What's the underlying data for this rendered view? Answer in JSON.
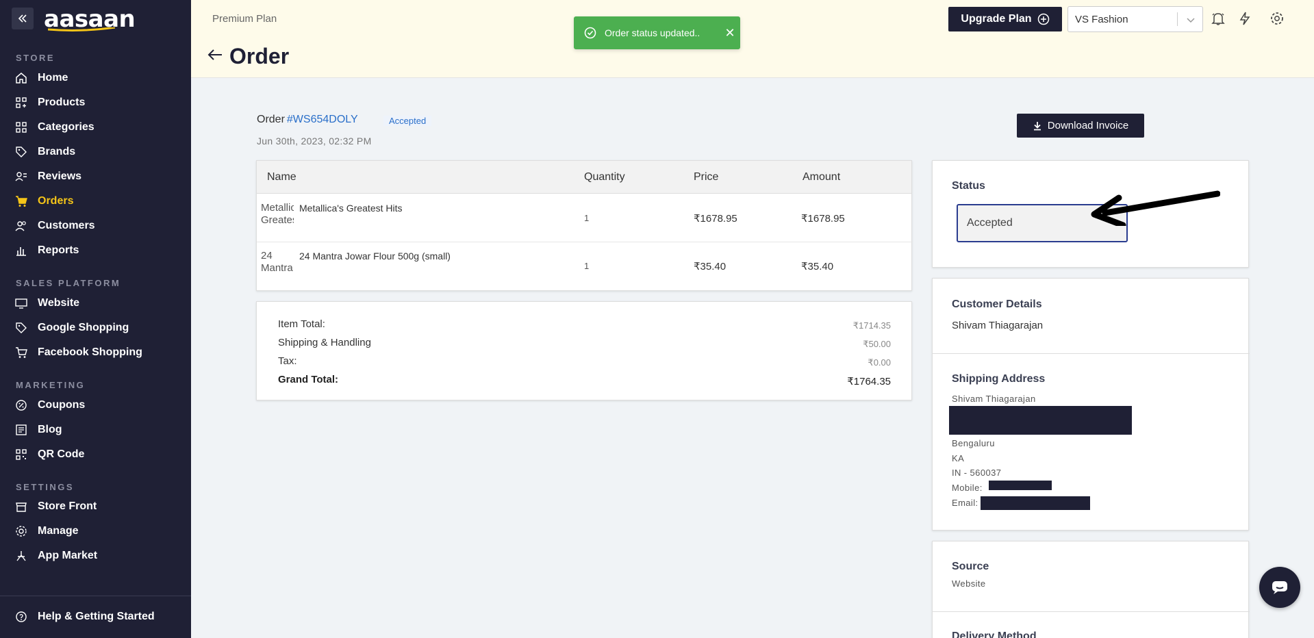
{
  "sidebar": {
    "logo": "aasaan",
    "sections": {
      "store": "STORE",
      "sales_platform": "SALES PLATFORM",
      "marketing": "MARKETING",
      "settings": "SETTINGS"
    },
    "items": [
      {
        "label": "Home",
        "icon": "home-icon"
      },
      {
        "label": "Products",
        "icon": "grid-icon"
      },
      {
        "label": "Categories",
        "icon": "categories-icon"
      },
      {
        "label": "Brands",
        "icon": "tag-icon"
      },
      {
        "label": "Reviews",
        "icon": "reviews-icon"
      },
      {
        "label": "Orders",
        "icon": "cart-icon",
        "active": true
      },
      {
        "label": "Customers",
        "icon": "users-icon"
      },
      {
        "label": "Reports",
        "icon": "bar-chart-icon"
      },
      {
        "label": "Website",
        "icon": "monitor-icon"
      },
      {
        "label": "Google Shopping",
        "icon": "google-tag-icon"
      },
      {
        "label": "Facebook Shopping",
        "icon": "cart-outline-icon"
      },
      {
        "label": "Coupons",
        "icon": "coupon-icon"
      },
      {
        "label": "Blog",
        "icon": "blog-icon"
      },
      {
        "label": "QR Code",
        "icon": "qr-icon"
      },
      {
        "label": "Store Front",
        "icon": "storefront-icon"
      },
      {
        "label": "Manage",
        "icon": "gear-icon"
      },
      {
        "label": "App Market",
        "icon": "app-market-icon"
      }
    ],
    "help": "Help & Getting Started"
  },
  "header": {
    "plan": "Premium Plan",
    "title": "Order",
    "toast": "Order status updated..",
    "upgrade": "Upgrade Plan",
    "store": "VS Fashion"
  },
  "order": {
    "label": "Order",
    "id": "#WS654DOLY",
    "badge": "Accepted",
    "date": "Jun 30th, 2023, 02:32 PM",
    "download": "Download Invoice",
    "columns": [
      "Name",
      "Quantity",
      "Price",
      "Amount"
    ],
    "items": [
      {
        "thumb_alt": "Metallica's Greatest",
        "name": "Metallica's Greatest Hits",
        "qty": "1",
        "price": "₹1678.95",
        "amount": "₹1678.95"
      },
      {
        "thumb_alt": "24 Mantra",
        "name": "24 Mantra Jowar Flour 500g (small)",
        "qty": "1",
        "price": "₹35.40",
        "amount": "₹35.40"
      }
    ],
    "totals": {
      "item_total_label": "Item Total:",
      "item_total": "₹1714.35",
      "shipping_label": "Shipping & Handling",
      "shipping": "₹50.00",
      "tax_label": "Tax:",
      "tax": "₹0.00",
      "grand_label": "Grand Total:",
      "grand": "₹1764.35"
    }
  },
  "status": {
    "title": "Status",
    "value": "Accepted"
  },
  "customer": {
    "title": "Customer Details",
    "name": "Shivam Thiagarajan"
  },
  "shipping": {
    "title": "Shipping Address",
    "name": "Shivam Thiagarajan",
    "city": "Bengaluru",
    "state": "KA",
    "postal": "IN - 560037",
    "mobile_label": "Mobile:",
    "email_label": "Email:"
  },
  "source": {
    "title": "Source",
    "value": "Website"
  },
  "delivery": {
    "title": "Delivery Method"
  },
  "colors": {
    "sidebar": "#1f2035",
    "active": "#f5c518",
    "link": "#2a6fc9",
    "toast": "#4caf50"
  }
}
